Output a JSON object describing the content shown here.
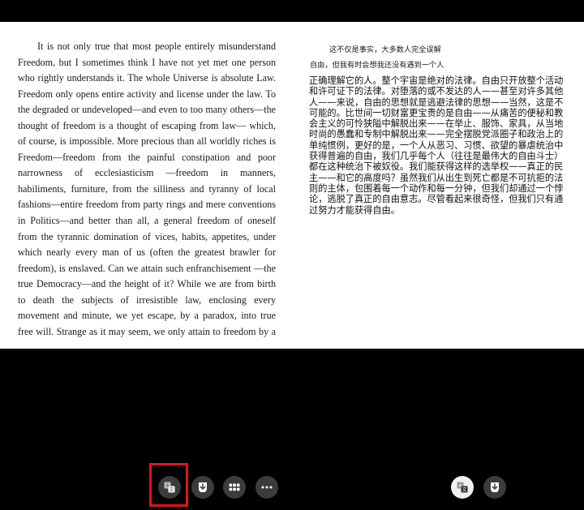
{
  "english_lines": [
    "It is not only true that most people entirely misunderstand",
    "Freedom, but I sometimes think I have not yet met one person",
    "who rightly understands it. The whole Universe is absolute Law.",
    "Freedom only opens entire activity and license under the law. To",
    "the degraded or undeveloped—and even to too many others—the",
    "thought of freedom is a thought of escaping from law— which,",
    "of course, is impossible. More precious than all worldly riches is",
    "Freedom—freedom from the painful constipation and poor",
    "narrowness of ecclesiasticism —freedom in manners,",
    "habiliments, furniture, from the silliness and tyranny of local",
    "fashions—entire freedom from party rings and mere conventions",
    "in Politics—and better than all, a general freedom of oneself",
    "from the tyrannic domination of vices, habits, appetites, under",
    "which nearly every man of us (often the greatest brawler for",
    "freedom), is enslaved. Can we attain such enfranchisement —the",
    "true Democracy—and the height of it? While we are from birth",
    "to death the subjects of irresistible law, enclosing every",
    "movement and minute, we yet escape, by a paradox, into true",
    "free will. Strange as it may seem, we only attain to freedom by a"
  ],
  "chinese_short_1": "这不仅是事实，大多数人完全误解",
  "chinese_short_2": "自由，但我有时会想我还没有遇到一个人",
  "chinese_lines": [
    "正确理解它的人。整个宇宙是绝对的法律。自由只开放整个活动",
    "和许可证下的法律。对堕落的或不发达的人——甚至对许多其他",
    "人——来说，自由的思想就是逃避法律的思想——当然，这是不",
    "可能的。比世间一切财富更宝贵的是自由——从痛苦的便秘和教",
    "会主义的可怜狭隘中解脱出来——在举止、服饰、家具，从当地",
    "时尚的愚蠢和专制中解脱出来——完全摆脱党派圈子和政治上的",
    "单纯惯例，更好的是，一个人从恶习、习惯、欲望的暴虐统治中",
    "获得普遍的自由，我们几乎每个人（往往是最伟大的自由斗士）",
    "都在这种统治下被奴役。我们能获得这样的选举权——真正的民",
    "主——和它的高度吗？虽然我们从出生到死亡都是不可抗拒的法",
    "则的主体，包围着每一个动作和每一分钟，但我们却通过一个悖",
    "论，逃脱了真正的自由意志。尽管看起来很奇怪，但我们只有通",
    "过努力才能获得自由。"
  ],
  "toolbar": {
    "left_buttons": [
      "translate-icon",
      "download-icon",
      "grid-icon",
      "more-icon"
    ],
    "right_buttons": [
      "translate-icon",
      "download-icon"
    ]
  },
  "colors": {
    "background": "#000000",
    "page": "#ffffff",
    "button_dark": "#3c3c3c",
    "button_light": "#f0f0f0",
    "highlight": "#e0141a"
  }
}
